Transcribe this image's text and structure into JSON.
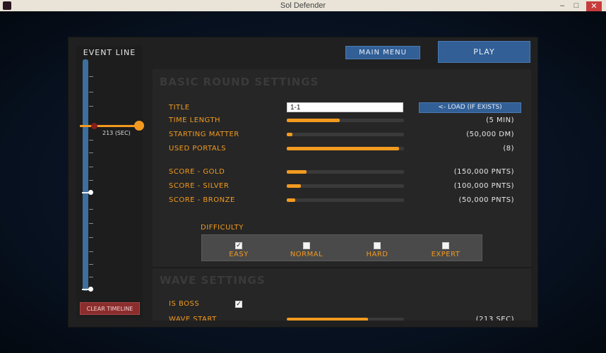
{
  "window": {
    "title": "Sol Defender",
    "controls": [
      "–",
      "□",
      "✕"
    ]
  },
  "event_line": {
    "title": "EVENT LINE",
    "position_label": "213 (SEC)",
    "clear_label": "CLEAR TIMELINE"
  },
  "top_buttons": {
    "main_menu": "MAIN MENU",
    "play": "PLAY"
  },
  "basic_round": {
    "section_title": "BASIC ROUND SETTINGS",
    "title_label": "TITLE",
    "title_value": "1-1",
    "load_label": "<- LOAD (IF EXISTS)",
    "rows": [
      {
        "label": "TIME LENGTH",
        "value": "(5 MIN)",
        "fill": 0.45
      },
      {
        "label": "STARTING MATTER",
        "value": "(50,000 DM)",
        "fill": 0.05
      },
      {
        "label": "USED PORTALS",
        "value": "(8)",
        "fill": 0.96
      },
      {
        "label": "SCORE - GOLD",
        "value": "(150,000 PNTS)",
        "fill": 0.17
      },
      {
        "label": "SCORE - SILVER",
        "value": "(100,000 PNTS)",
        "fill": 0.12
      },
      {
        "label": "SCORE - BRONZE",
        "value": "(50,000 PNTS)",
        "fill": 0.07
      }
    ],
    "difficulty_label": "DIFFICULTY",
    "difficulty": [
      {
        "label": "EASY",
        "checked": true
      },
      {
        "label": "NORMAL",
        "checked": false
      },
      {
        "label": "HARD",
        "checked": false
      },
      {
        "label": "EXPERT",
        "checked": false
      }
    ]
  },
  "wave": {
    "section_title": "WAVE SETTINGS",
    "is_boss_label": "IS BOSS",
    "is_boss_checked": true,
    "wave_start_label": "WAVE START",
    "wave_start_value": "(213 SEC)",
    "wave_start_fill": 0.69
  },
  "colors": {
    "accent_orange": "#f29a1f",
    "button_blue": "#315f96",
    "clear_red": "#8c2d2d"
  }
}
